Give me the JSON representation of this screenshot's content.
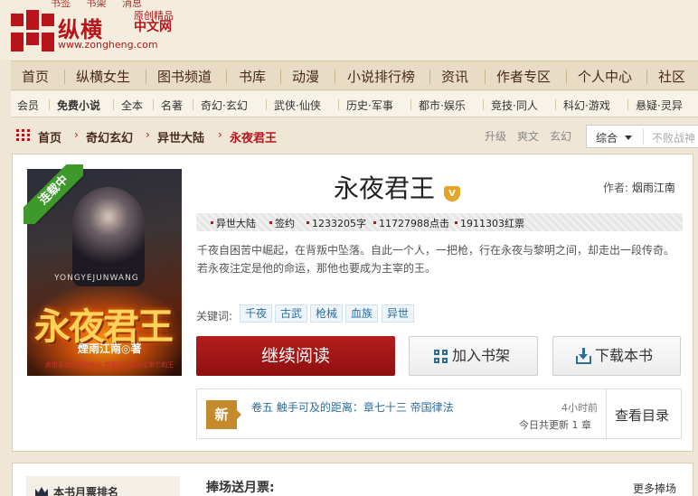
{
  "top_links": [
    "书签",
    "书架",
    "消息"
  ],
  "logo": {
    "name": "纵横",
    "tag_top": "原创精品",
    "tag_bottom": "中文网",
    "url": "www.zongheng.com"
  },
  "main_nav": [
    "首页",
    "纵横女生",
    "图书频道",
    "书库",
    "动漫",
    "小说排行榜",
    "资讯",
    "作者专区",
    "个人中心",
    "社区"
  ],
  "sub_nav": [
    "会员",
    "免费小说",
    "全本",
    "名著",
    "奇幻·玄幻",
    "武侠·仙侠",
    "历史·军事",
    "都市·娱乐",
    "竞技·同人",
    "科幻·游戏",
    "悬疑·灵异"
  ],
  "breadcrumb": [
    "首页",
    "奇幻玄幻",
    "异世大陆",
    "永夜君王"
  ],
  "tag_links": [
    "升级",
    "爽文",
    "玄幻"
  ],
  "search": {
    "sort_label": "综合",
    "placeholder": "不败战神"
  },
  "book": {
    "title": "永夜君王",
    "vip_badge": "V",
    "author_label": "作者:",
    "author": "烟雨江南",
    "status_ribbon": "连载中",
    "cover": {
      "pinyin": "YONGYEJUNWANG",
      "title_art": "永夜君王",
      "author_art": "煙雨江南◎著",
      "tiny": "此世永夜是我的命运 若我注定成为主宰它的王"
    },
    "meta": [
      "异世大陆",
      "签约",
      "1233205字",
      "11727988点击",
      "1911303红票"
    ],
    "description": "千夜自困苦中崛起，在背叛中坠落。自此一个人，一把枪，行在永夜与黎明之间，却走出一段传奇。若永夜注定是他的命运，那他也要成为主宰的王。",
    "keywords_label": "关键词:",
    "keywords": [
      "千夜",
      "古武",
      "枪械",
      "血族",
      "异世"
    ],
    "actions": {
      "read": "继续阅读",
      "shelf": "加入书架",
      "download": "下载本书"
    },
    "latest": {
      "badge": "新",
      "chapter": "卷五 触手可及的距离：章七十三 帝国律法",
      "time": "4小时前",
      "count": "今日共更新 1 章",
      "catalog": "查看目录"
    }
  },
  "lower": {
    "rank_title": "本书月票排名",
    "support_title": "捧场送月票:",
    "more": "更多捧场"
  },
  "colors": {
    "brand_red": "#b8141a",
    "link_blue": "#2c6e9a",
    "ribbon_green": "#3d9a2a"
  }
}
